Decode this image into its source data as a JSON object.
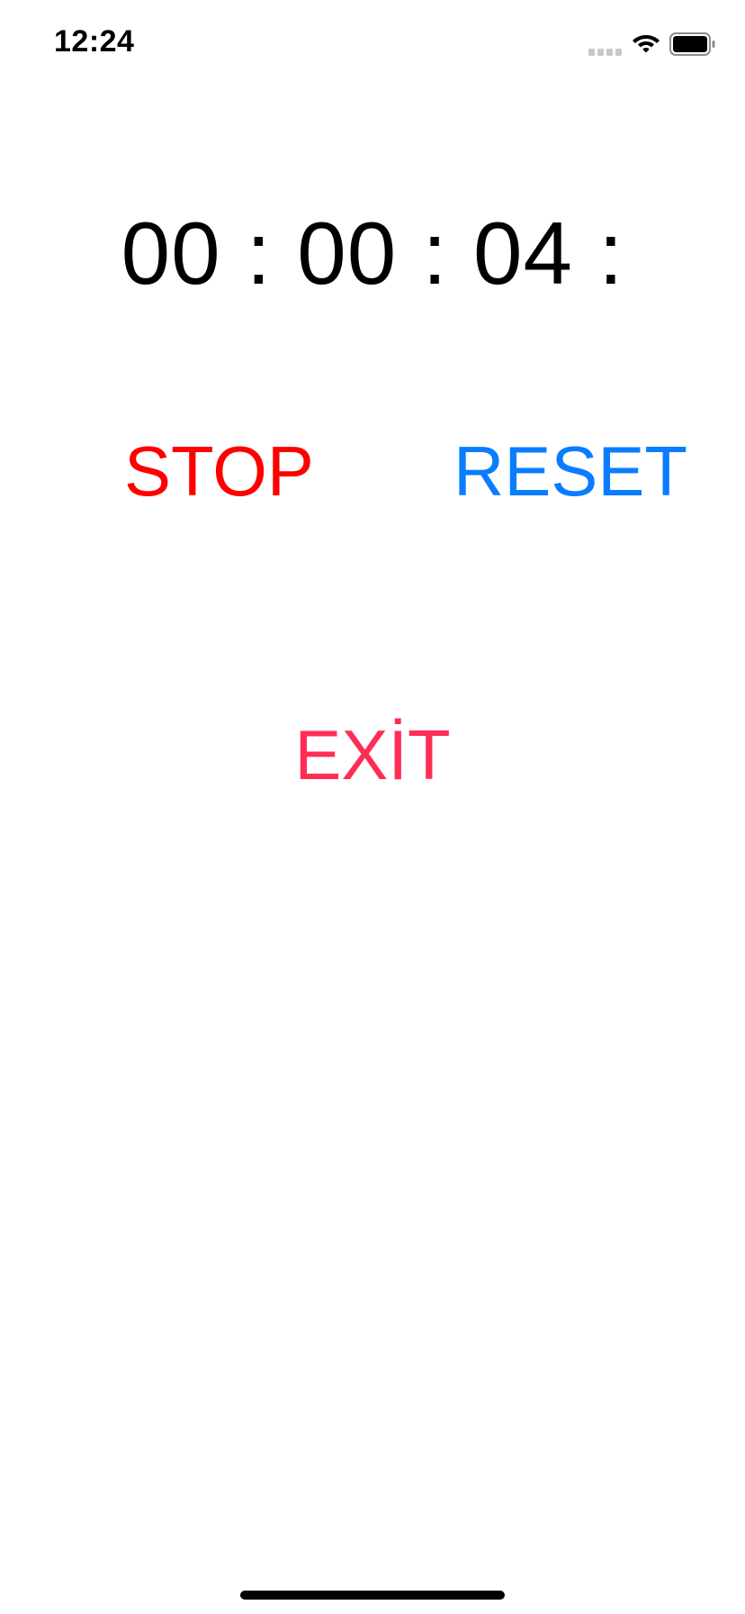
{
  "status_bar": {
    "time": "12:24",
    "icons": [
      "cellular-signal-icon",
      "wifi-icon",
      "battery-icon"
    ]
  },
  "timer": {
    "display": "00 : 00 : 04 :"
  },
  "buttons": {
    "stop_label": "STOP",
    "reset_label": "RESET",
    "exit_label": "EXİT"
  },
  "colors": {
    "stop": "#ff0000",
    "reset": "#0a7cff",
    "exit": "#ff2d55",
    "text": "#000000",
    "background": "#ffffff"
  }
}
